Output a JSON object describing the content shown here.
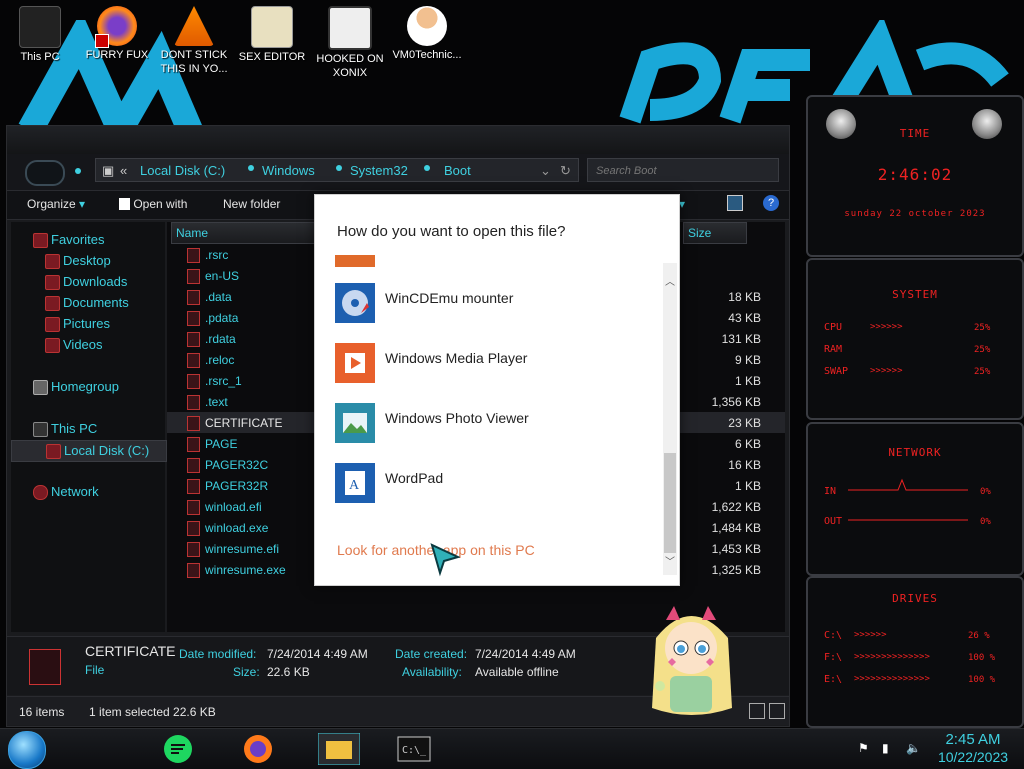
{
  "desktop": {
    "icons": [
      {
        "label": "This PC",
        "icon": "this-pc-icon"
      },
      {
        "label": "FURRY FUX",
        "icon": "firefox-icon"
      },
      {
        "label": "DONT STICK THIS IN YO...",
        "icon": "vlc-icon"
      },
      {
        "label": "SEX EDITOR",
        "icon": "hxd-icon"
      },
      {
        "label": "HOOKED ON XONIX",
        "icon": "game-icon"
      },
      {
        "label": "VM0Technic...",
        "icon": "doctor-icon"
      }
    ]
  },
  "explorer": {
    "breadcrumb": [
      "Local Disk (C:)",
      "Windows",
      "System32",
      "Boot"
    ],
    "search_placeholder": "Search Boot",
    "toolbar": {
      "organize": "Organize",
      "open_with": "Open with",
      "new_folder": "New folder"
    },
    "nav": {
      "favorites": "Favorites",
      "desktop": "Desktop",
      "downloads": "Downloads",
      "documents": "Documents",
      "pictures": "Pictures",
      "videos": "Videos",
      "homegroup": "Homegroup",
      "this_pc": "This PC",
      "local_disk": "Local Disk (C:)",
      "network": "Network"
    },
    "columns": {
      "name": "Name",
      "size": "Size"
    },
    "files": [
      {
        "name": ".rsrc",
        "size": ""
      },
      {
        "name": "en-US",
        "size": ""
      },
      {
        "name": ".data",
        "size": "18 KB"
      },
      {
        "name": ".pdata",
        "size": "43 KB"
      },
      {
        "name": ".rdata",
        "size": "131 KB"
      },
      {
        "name": ".reloc",
        "size": "9 KB"
      },
      {
        "name": ".rsrc_1",
        "size": "1 KB"
      },
      {
        "name": ".text",
        "size": "1,356 KB"
      },
      {
        "name": "CERTIFICATE",
        "size": "23 KB"
      },
      {
        "name": "PAGE",
        "size": "6 KB"
      },
      {
        "name": "PAGER32C",
        "size": "16 KB"
      },
      {
        "name": "PAGER32R",
        "size": "1 KB"
      },
      {
        "name": "winload.efi",
        "size": "1,622 KB"
      },
      {
        "name": "winload.exe",
        "size": "1,484 KB"
      },
      {
        "name": "winresume.efi",
        "size": "1,453 KB"
      },
      {
        "name": "winresume.exe",
        "size": "1,325 KB"
      }
    ],
    "details": {
      "name": "CERTIFICATE",
      "type": "File",
      "date_modified_label": "Date modified:",
      "date_modified": "7/24/2014 4:49 AM",
      "size_label": "Size:",
      "size": "22.6 KB",
      "date_created_label": "Date created:",
      "date_created": "7/24/2014 4:49 AM",
      "availability_label": "Availability:",
      "availability": "Available offline"
    },
    "status": {
      "items": "16 items",
      "selected": "1 item selected  22.6 KB"
    }
  },
  "dialog": {
    "title": "How do you want to open this file?",
    "apps": [
      {
        "name": "WinCDEmu mounter",
        "icon": "wincdemu-icon"
      },
      {
        "name": "Windows Media Player",
        "icon": "media-player-icon"
      },
      {
        "name": "Windows Photo Viewer",
        "icon": "photo-viewer-icon"
      },
      {
        "name": "WordPad",
        "icon": "wordpad-icon"
      }
    ],
    "look_link": "Look for another app on this PC"
  },
  "gadgets": {
    "time": {
      "title": "TIME",
      "clock": "2:46:02",
      "date": "sunday 22 october 2023"
    },
    "system": {
      "title": "SYSTEM",
      "cpu_label": "CPU",
      "cpu_value": "25%",
      "ram_label": "RAM",
      "ram_value": "25%",
      "swap_label": "SWAP",
      "swap_value": "25%"
    },
    "network": {
      "title": "NETWORK",
      "in_label": "IN",
      "in_value": "0%",
      "out_label": "OUT",
      "out_value": "0%"
    },
    "drives": {
      "title": "DRIVES",
      "c_label": "C:\\",
      "c_value": "26 %",
      "f_label": "F:\\",
      "f_value": "100 %",
      "e_label": "E:\\",
      "e_value": "100 %"
    }
  },
  "taskbar": {
    "time": "2:45 AM",
    "date": "10/22/2023"
  },
  "colors": {
    "accent_cyan": "#3fd0e0",
    "gadget_red": "#ee2222",
    "link_orange": "#e07a4e"
  }
}
